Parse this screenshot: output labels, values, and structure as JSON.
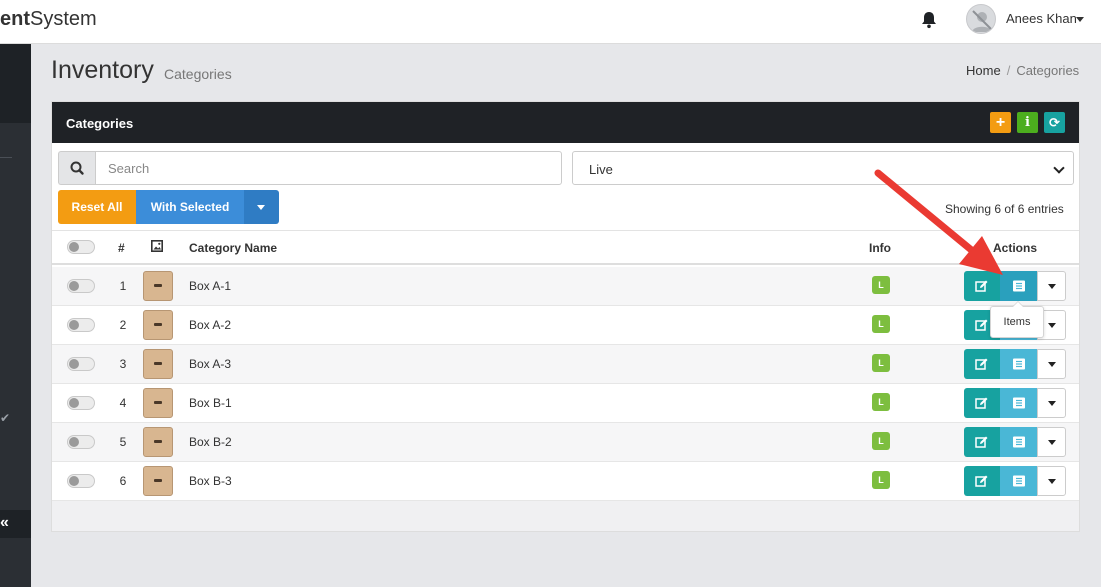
{
  "topbar": {
    "brand_bold": "ent",
    "brand_rest": "System",
    "user_name": "Anees Khan"
  },
  "page": {
    "title": "Inventory",
    "subtitle": "Categories",
    "breadcrumb": [
      "Home",
      "Categories"
    ]
  },
  "panel": {
    "title": "Categories",
    "header_buttons": [
      {
        "icon": "plus-icon",
        "label": "+"
      },
      {
        "icon": "info-icon",
        "label": "i"
      },
      {
        "icon": "refresh-icon",
        "label": "⟳"
      }
    ]
  },
  "filters": {
    "search_placeholder": "Search",
    "status_value": "Live",
    "reset_label": "Reset All",
    "with_selected_label": "With Selected",
    "showing": "Showing 6 of 6 entries"
  },
  "table": {
    "columns": {
      "num": "#",
      "name": "Category Name",
      "info": "Info",
      "actions": "Actions"
    },
    "rows": [
      {
        "num": "1",
        "name": "Box A-1",
        "info": "L"
      },
      {
        "num": "2",
        "name": "Box A-2",
        "info": "L"
      },
      {
        "num": "3",
        "name": "Box A-3",
        "info": "L"
      },
      {
        "num": "4",
        "name": "Box B-1",
        "info": "L"
      },
      {
        "num": "5",
        "name": "Box B-2",
        "info": "L"
      },
      {
        "num": "6",
        "name": "Box B-3",
        "info": "L"
      }
    ]
  },
  "tooltip": {
    "text": "Items"
  },
  "colors": {
    "accent_orange": "#f39c12",
    "accent_blue": "#3c8dd9",
    "accent_teal": "#17a2a0",
    "badge_green": "#7dbe3f",
    "annotation_arrow": "#ea3a32"
  }
}
